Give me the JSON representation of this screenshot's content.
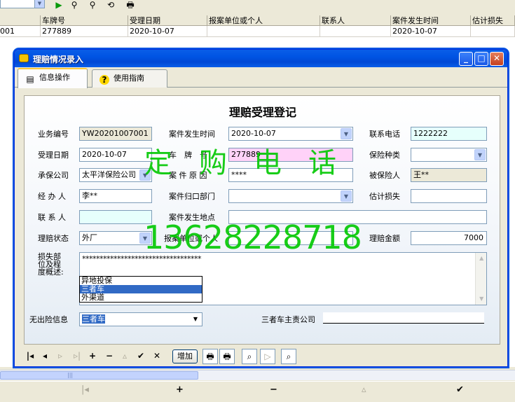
{
  "bg": {
    "grid_headers": [
      "",
      "车牌号",
      "受理日期",
      "报案单位或个人",
      "联系人",
      "案件发生时间",
      "估计损失"
    ],
    "grid_row": [
      "001",
      "277889",
      "2020-10-07",
      "",
      "",
      "2020-10-07",
      ""
    ],
    "nav": {
      "first": "|◂",
      "add": "+",
      "remove": "−",
      "edit": "▵",
      "post": "✔"
    }
  },
  "dialog": {
    "title": "理赔情况录入",
    "tabs": [
      {
        "label": "信息操作",
        "active": true
      },
      {
        "label": "使用指南",
        "active": false
      }
    ],
    "form_title": "理赔受理登记",
    "fields": {
      "biz_no": {
        "label": "业务编号",
        "value": "YW20201007001"
      },
      "case_time": {
        "label": "案件发生时间",
        "value": "2020-10-07"
      },
      "phone": {
        "label": "联系电话",
        "value": "1222222"
      },
      "accept_date": {
        "label": "受理日期",
        "value": "2020-10-07"
      },
      "plate": {
        "label": "车　牌　号",
        "value": "277889"
      },
      "ins_type": {
        "label": "保险种类",
        "value": ""
      },
      "insurer": {
        "label": "承保公司",
        "value": "太平洋保险公司"
      },
      "cause": {
        "label": "案 件 原 因",
        "value": "****"
      },
      "insured": {
        "label": "被保险人",
        "value": "王**"
      },
      "handler": {
        "label": "经 办 人",
        "value": "李**"
      },
      "dept": {
        "label": "案件归口部门",
        "value": ""
      },
      "est_loss": {
        "label": "估计损失",
        "value": ""
      },
      "contact": {
        "label": "联 系 人",
        "value": ""
      },
      "location": {
        "label": "案件发生地点",
        "value": ""
      },
      "status": {
        "label": "理赔状态",
        "value": "外厂"
      },
      "reporter": {
        "label": "报案单位或个人",
        "value": ""
      },
      "amount": {
        "label": "理赔金额",
        "value": "7000"
      },
      "damage": {
        "label": "损失部位及程度概述:",
        "value": "**********************************"
      },
      "no_claim": {
        "label": "无出险信息",
        "value": "三者车"
      },
      "third_co": {
        "label": "三者车主责公司",
        "value": ""
      }
    },
    "dropdown_options": [
      "异地投保",
      "三者车",
      "外渠道"
    ],
    "dropdown_selected": "三者车",
    "toolbar": {
      "first": "|◂",
      "prior": "◂",
      "next": "▹",
      "last": "▹|",
      "insert": "+",
      "delete": "−",
      "edit": "▵",
      "post": "✔",
      "cancel": "✕",
      "add_label": "增加"
    }
  },
  "watermark": {
    "line1": "定购电话",
    "line2": "13628228718",
    "color": "#00c800"
  }
}
